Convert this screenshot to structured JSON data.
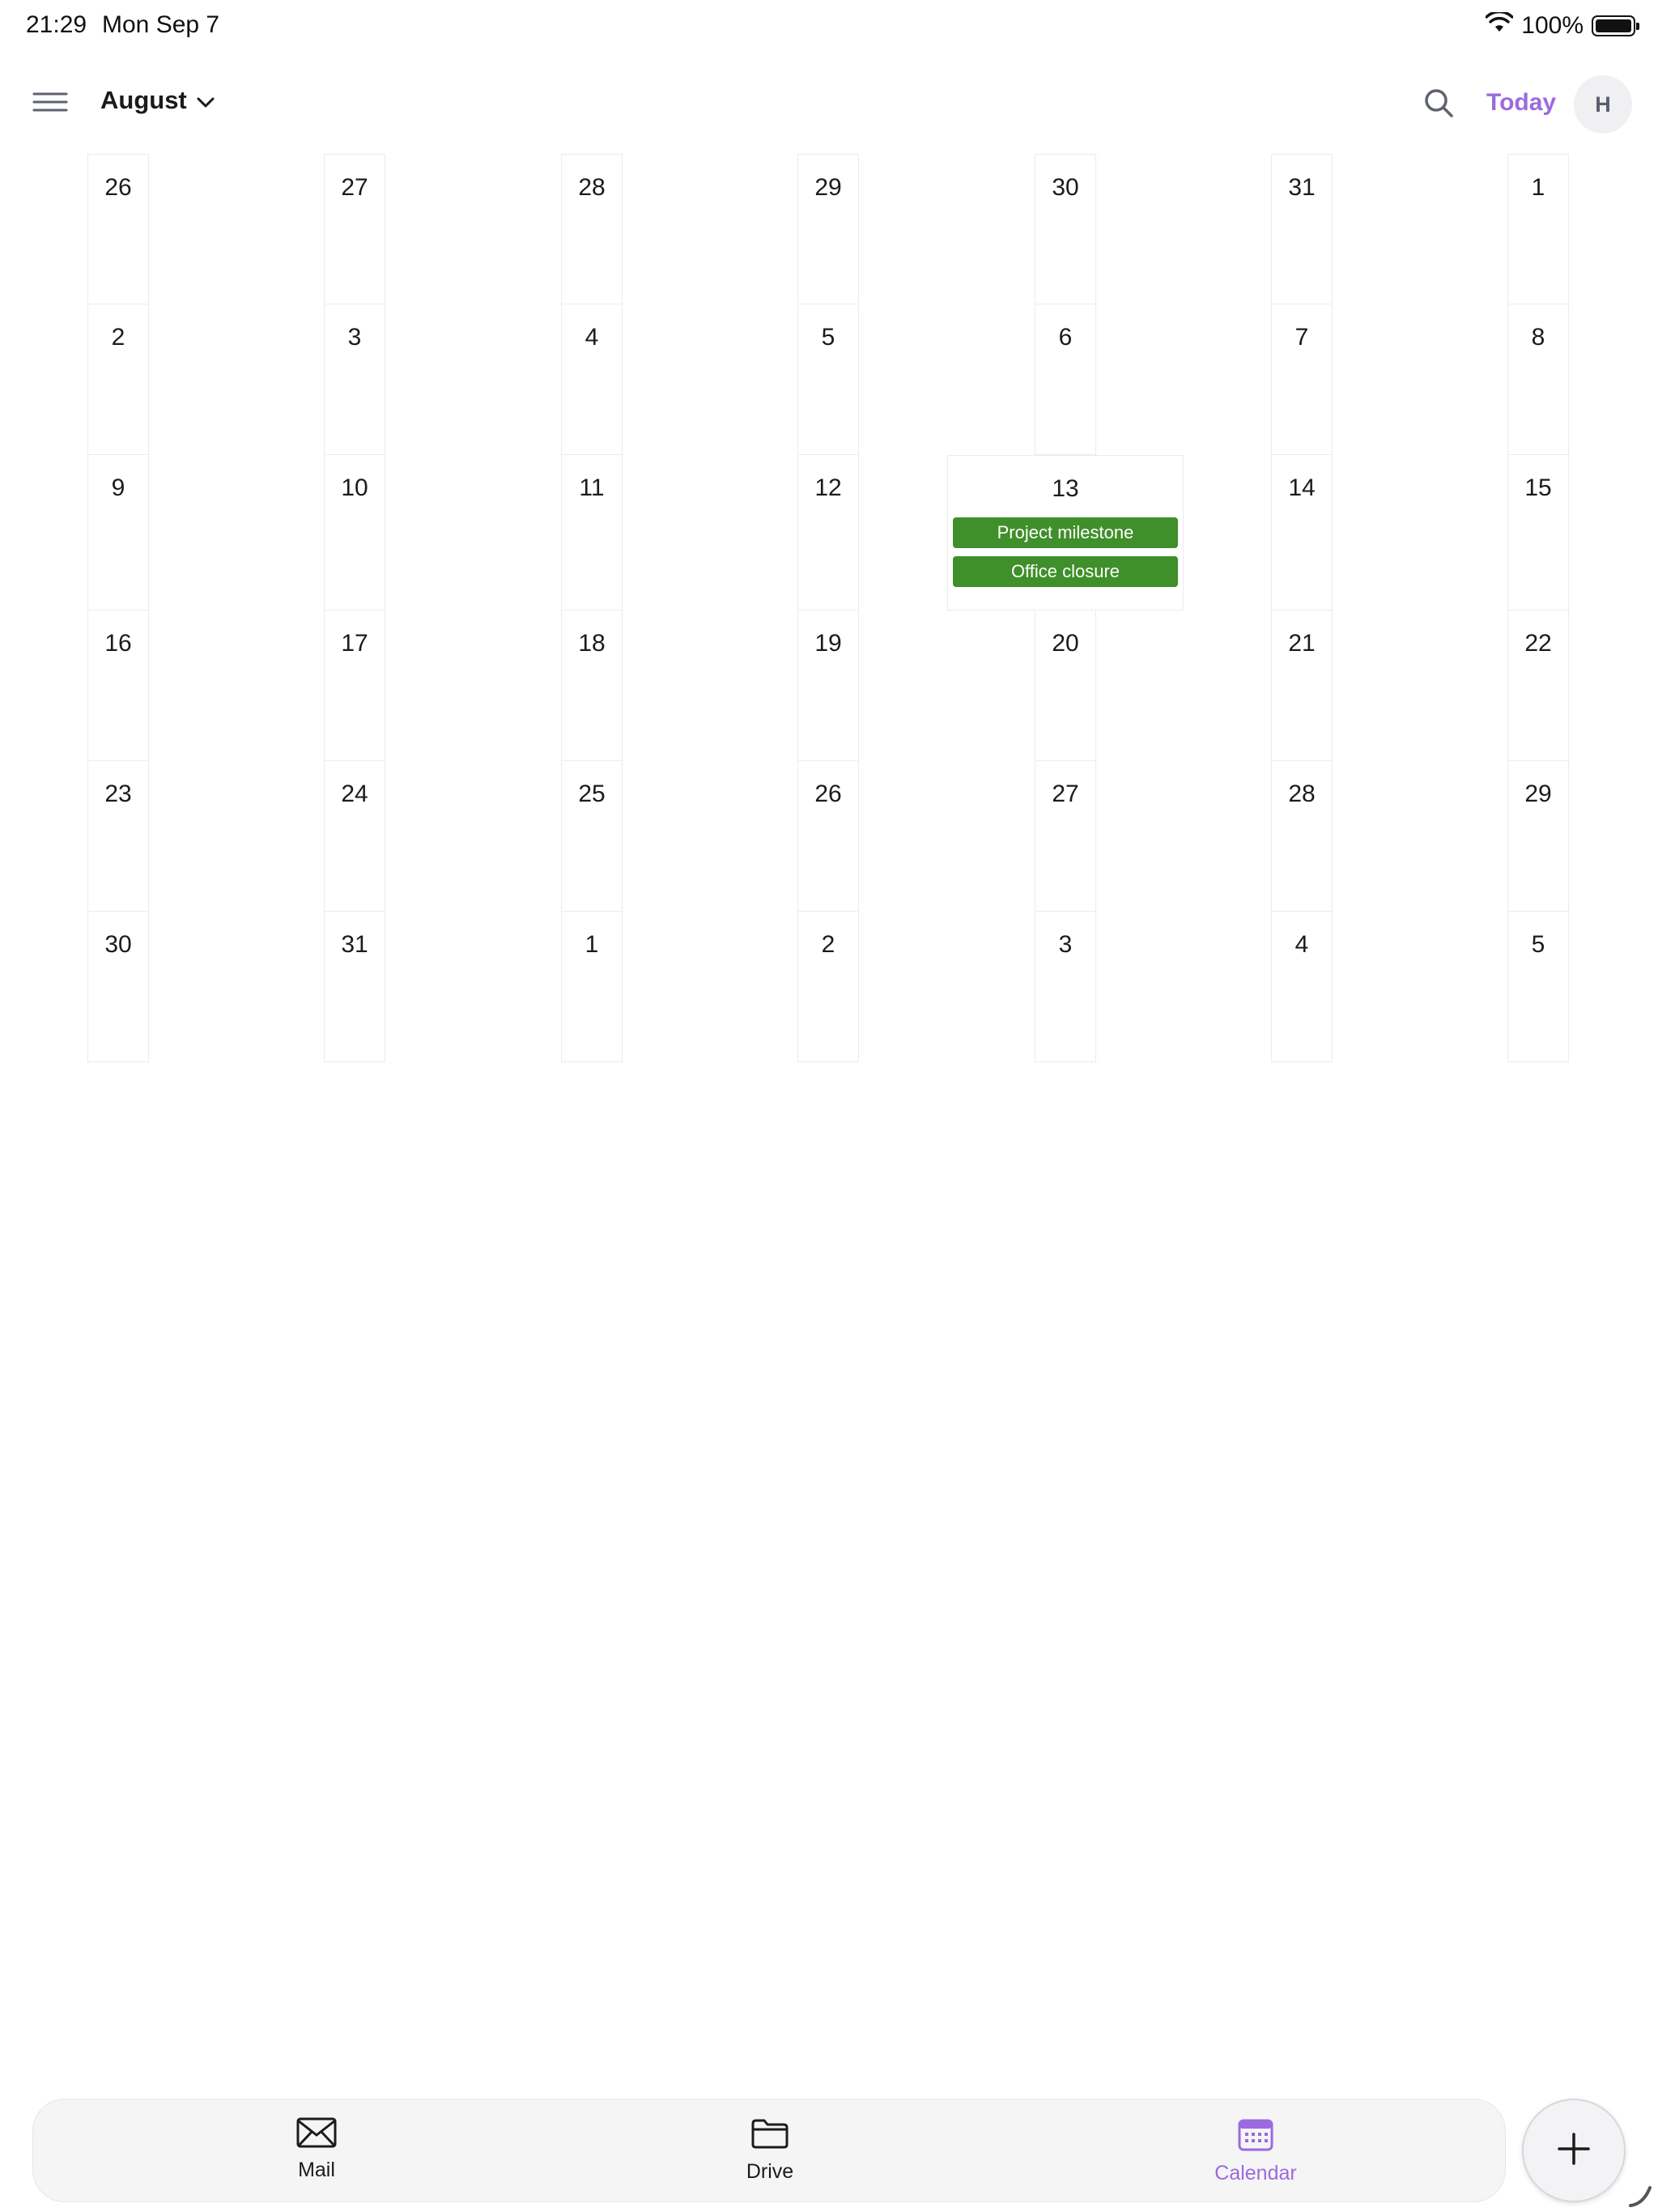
{
  "status_bar": {
    "time": "21:29",
    "date": "Mon Sep 7",
    "battery": "100%",
    "icons": [
      "wifi-icon",
      "battery-icon"
    ]
  },
  "header": {
    "month": "August",
    "today_label": "Today",
    "avatar_initial": "H",
    "icons": [
      "menu-icon",
      "chevron-down-icon",
      "search-icon"
    ]
  },
  "calendar": {
    "weeks": [
      [
        "26",
        "27",
        "28",
        "29",
        "30",
        "31",
        "1"
      ],
      [
        "2",
        "3",
        "4",
        "5",
        "6",
        "7",
        "8"
      ],
      [
        "9",
        "10",
        "11",
        "12",
        "13",
        "14",
        "15"
      ],
      [
        "16",
        "17",
        "18",
        "19",
        "20",
        "21",
        "22"
      ],
      [
        "23",
        "24",
        "25",
        "26",
        "27",
        "28",
        "29"
      ],
      [
        "30",
        "31",
        "1",
        "2",
        "3",
        "4",
        "5"
      ]
    ],
    "selected_day": "13",
    "events": [
      {
        "title": "Project milestone",
        "color": "#3f8f2a"
      },
      {
        "title": "Office closure",
        "color": "#3f8f2a"
      }
    ]
  },
  "bottom_nav": {
    "items": [
      {
        "label": "Mail",
        "icon": "mail-icon"
      },
      {
        "label": "Drive",
        "icon": "folder-icon"
      },
      {
        "label": "Calendar",
        "icon": "calendar-icon"
      }
    ],
    "active": "Calendar",
    "accent_color": "#9c6ade"
  },
  "fab": {
    "icon": "plus-icon"
  }
}
